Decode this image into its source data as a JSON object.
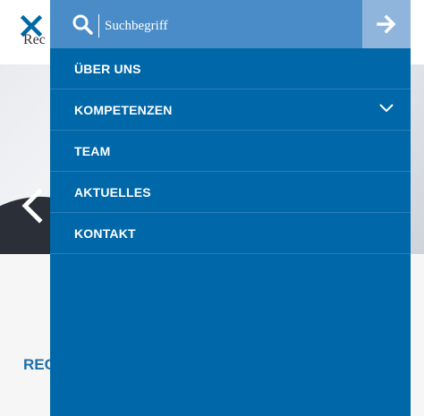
{
  "background": {
    "logo_fragment": "Rec",
    "heading_fragment": "REC AUS"
  },
  "menu": {
    "search": {
      "placeholder": "Suchbegriff"
    },
    "items": [
      {
        "label": "ÜBER UNS",
        "has_submenu": false
      },
      {
        "label": "KOMPETENZEN",
        "has_submenu": true
      },
      {
        "label": "TEAM",
        "has_submenu": false
      },
      {
        "label": "AKTUELLES",
        "has_submenu": false
      },
      {
        "label": "KONTAKT",
        "has_submenu": false
      }
    ]
  },
  "icons": {
    "close": "close-icon",
    "search": "search-icon",
    "submit": "arrow-right-icon",
    "prev": "chevron-left-icon",
    "expand": "chevron-down-icon"
  },
  "colors": {
    "menu_bg": "#0067a8",
    "search_bg": "#4a8cc7",
    "submit_bg": "#8fb5dc",
    "accent": "#1f6fa8"
  }
}
